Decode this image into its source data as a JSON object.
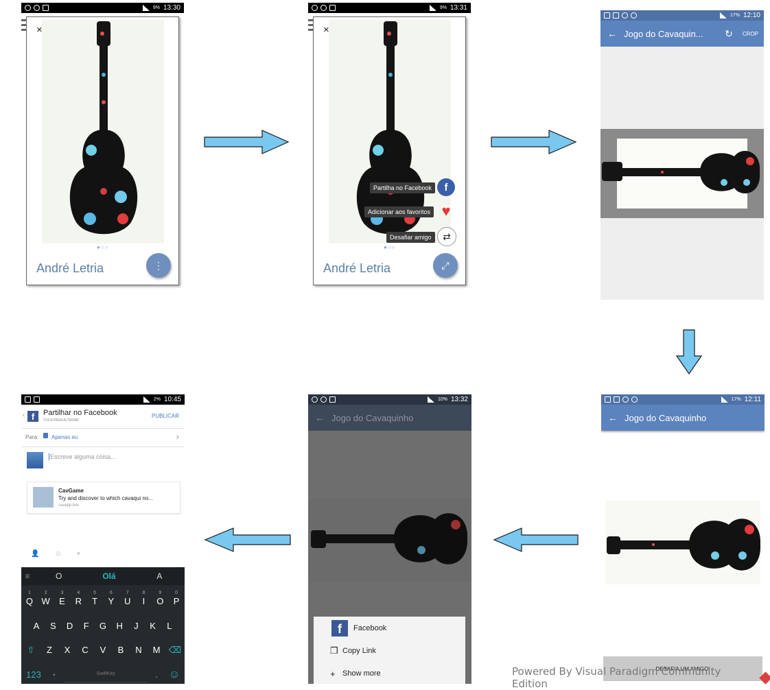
{
  "screen1": {
    "status_time": "13:30",
    "status_battery": "9%",
    "artist": "André Letria",
    "close_label": "×",
    "fab_label": "⋮"
  },
  "screen2": {
    "status_time": "13:31",
    "status_battery": "9%",
    "artist": "André Letria",
    "close_label": "×",
    "tooltips": [
      "Partilha no Facebook",
      "Adicionar aos favoritos",
      "Desafiar amigo"
    ],
    "fab_label": "⤢"
  },
  "screen3": {
    "status_time": "12:10",
    "status_battery": "17%",
    "title": "Jogo do Cavaquin...",
    "crop_label": "CROP"
  },
  "screen4": {
    "status_time": "12:11",
    "status_battery": "17%",
    "title": "Jogo do Cavaquinho",
    "bottom_button": "DESAFIA UM AMIGO!"
  },
  "screen5": {
    "status_time": "13:32",
    "status_battery": "10%",
    "title": "Jogo do Cavaquinho",
    "share_items": [
      "Facebook",
      "Copy Link",
      "Show more"
    ]
  },
  "screen6": {
    "status_time": "10:45",
    "status_battery": "2%",
    "header_title": "Partilhar no Facebook",
    "header_sub": "TOCA PARA ALTERAR",
    "publish": "PUBLICAR",
    "to_label": "Para:",
    "audience": "Apenas eu",
    "compose_placeholder": "Escreve alguma coisa...",
    "link_title": "CavGame",
    "link_desc": "Try and discover to which cavaqui no...",
    "link_domain": "cavapp.live",
    "suggestions": [
      "O",
      "Olá",
      "A"
    ],
    "keys_row1": [
      "Q",
      "W",
      "E",
      "R",
      "T",
      "Y",
      "U",
      "I",
      "O",
      "P"
    ],
    "keys_row1_alt": [
      "1",
      "2",
      "3",
      "4",
      "5",
      "6",
      "7",
      "8",
      "9",
      "0"
    ],
    "keys_row2": [
      "A",
      "S",
      "D",
      "F",
      "G",
      "H",
      "J",
      "K",
      "L"
    ],
    "keys_row3": [
      "Z",
      "X",
      "C",
      "V",
      "B",
      "N",
      "M"
    ],
    "key_num": "123",
    "key_brand": "SwiftKey"
  },
  "watermark": "Powered By Visual Paradigm Community Edition",
  "colors": {
    "arrow": "#79c8ef",
    "appbar_blue": "#5b83bd",
    "status_black": "#000000",
    "fab": "#6f8fbe",
    "dim_appbar": "#3d4858",
    "keyboard": "#262a2c",
    "accent_teal": "#2ab3c4"
  }
}
